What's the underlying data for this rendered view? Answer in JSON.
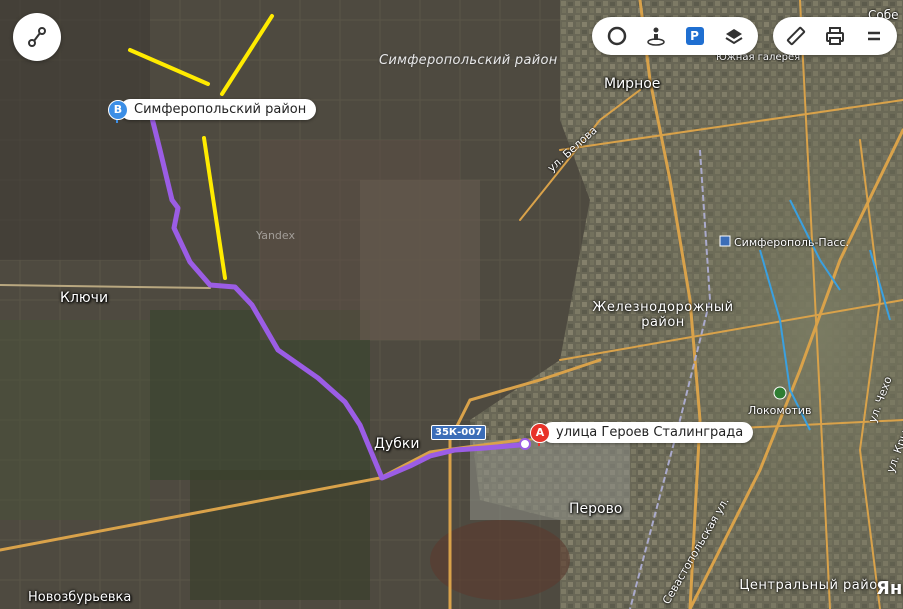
{
  "labels": {
    "simf_district": "Симферопольский район",
    "mirnoe": "Мирное",
    "klyuchi": "Ключи",
    "dubki": "Дубки",
    "perovo": "Перово",
    "novozbur": "Новозбурьевка",
    "zhd_district": "Железнодорожный район",
    "central_district": "Центральный район",
    "ul_belova": "ул. Белова",
    "ul_sevast": "Севастопольская ул.",
    "ul_chek": "ул. Чехо",
    "ul_kry": "ул. Кры",
    "simf_pass": "Симферополь-Пасс.",
    "lokomotiv": "Локомотив",
    "yuzhnaya": "Южная галерея",
    "yandex_wm": "Yandex",
    "yandex_logo": "Янд",
    "road_code": "35К-007",
    "corner_top": "Собе"
  },
  "markers": {
    "A": {
      "letter": "A",
      "label": "улица Героев Сталинграда",
      "color": "#e8332a"
    },
    "B": {
      "letter": "B",
      "label": "Симферопольский район",
      "color": "#3b8ee6"
    }
  },
  "controls": {
    "route_icon": "route-icon",
    "circle_icon": "circle-icon",
    "panorama_icon": "panorama-icon",
    "parking_letter": "P",
    "layers_icon": "layers-icon",
    "ruler_icon": "ruler-icon",
    "print_icon": "print-icon",
    "menu_icon": "menu-icon"
  },
  "colors": {
    "route": "#9b5de5",
    "annotation": "#ffeb00",
    "road": "#e8a33a",
    "parking": "#1f6fd1"
  }
}
